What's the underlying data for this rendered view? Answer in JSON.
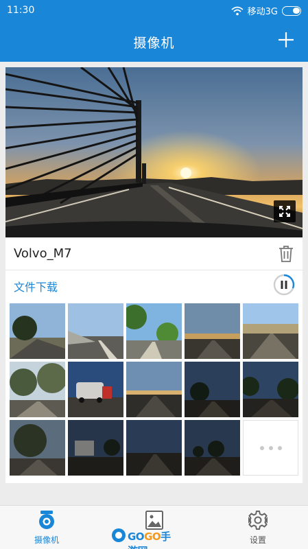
{
  "status_bar": {
    "time": "11:30",
    "carrier": "移动3G"
  },
  "header": {
    "title": "摄像机"
  },
  "camera": {
    "name": "Volvo_M7",
    "download_label": "文件下载"
  },
  "nav": {
    "items": [
      {
        "label": "摄像机",
        "active": true
      },
      {
        "label": "相册",
        "active": false
      },
      {
        "label": "设置",
        "active": false
      }
    ]
  },
  "watermark": {
    "brand_a": "GO",
    "brand_b": "GO",
    "brand_c": "手游网"
  },
  "colors": {
    "accent": "#1a86d8",
    "background": "#ececec"
  },
  "icons": [
    "wifi-icon",
    "battery-icon",
    "add-icon",
    "fullscreen-icon",
    "trash-icon",
    "pause-icon",
    "camera-icon",
    "gallery-icon",
    "gear-icon"
  ]
}
